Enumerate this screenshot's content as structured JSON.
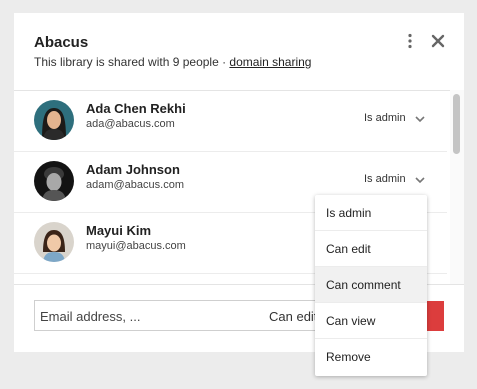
{
  "dialog": {
    "title": "Abacus",
    "subtitle_text": "This library is shared with 9 people · ",
    "subtitle_link": "domain sharing",
    "more_icon": "more-vertical-icon",
    "close_icon": "close-icon"
  },
  "members": [
    {
      "name": "Ada Chen Rekhi",
      "email": "ada@abacus.com",
      "role": "Is admin"
    },
    {
      "name": "Adam Johnson",
      "email": "adam@abacus.com",
      "role": "Is admin"
    },
    {
      "name": "Mayui Kim",
      "email": "mayui@abacus.com",
      "role": ""
    }
  ],
  "invite": {
    "placeholder": "Email address, ...",
    "role": "Can edit"
  },
  "role_menu": {
    "items": [
      "Is admin",
      "Can edit",
      "Can comment",
      "Can view",
      "Remove"
    ],
    "highlighted": "Can comment"
  },
  "colors": {
    "accent_red": "#dc3d3d",
    "background": "#ececec",
    "dialog": "#ffffff"
  }
}
